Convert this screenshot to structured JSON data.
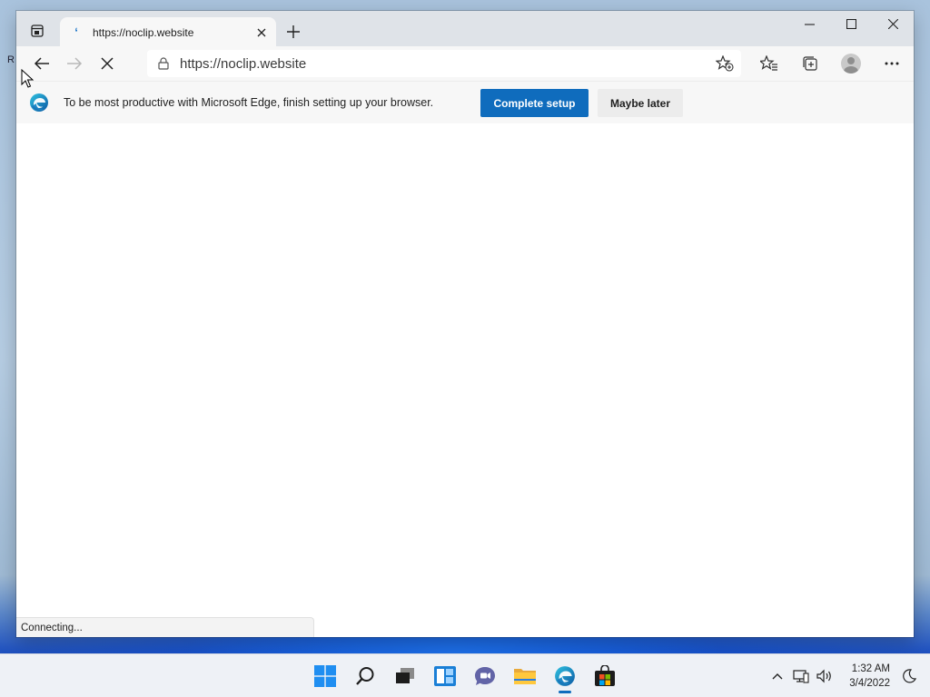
{
  "desktop": {
    "peek_text": "R"
  },
  "tab": {
    "title": "https://noclip.website"
  },
  "window_controls": {
    "minimize": "—",
    "maximize": "☐",
    "close": "✕"
  },
  "toolbar": {
    "url": "https://noclip.website",
    "back_icon": "arrow-left-icon",
    "forward_icon": "arrow-right-icon",
    "stop_icon": "close-icon"
  },
  "infobar": {
    "message": "To be most productive with Microsoft Edge, finish setting up your browser.",
    "primary_label": "Complete setup",
    "secondary_label": "Maybe later"
  },
  "status": {
    "text": "Connecting..."
  },
  "taskbar": {
    "apps": [
      "start",
      "search",
      "task-view",
      "widgets",
      "chat",
      "file-explorer",
      "edge",
      "store"
    ],
    "time": "1:32 AM",
    "date": "3/4/2022"
  },
  "colors": {
    "accent": "#0f6cbd",
    "titlebar": "#dfe3e8",
    "toolbar": "#f7f7f7"
  }
}
